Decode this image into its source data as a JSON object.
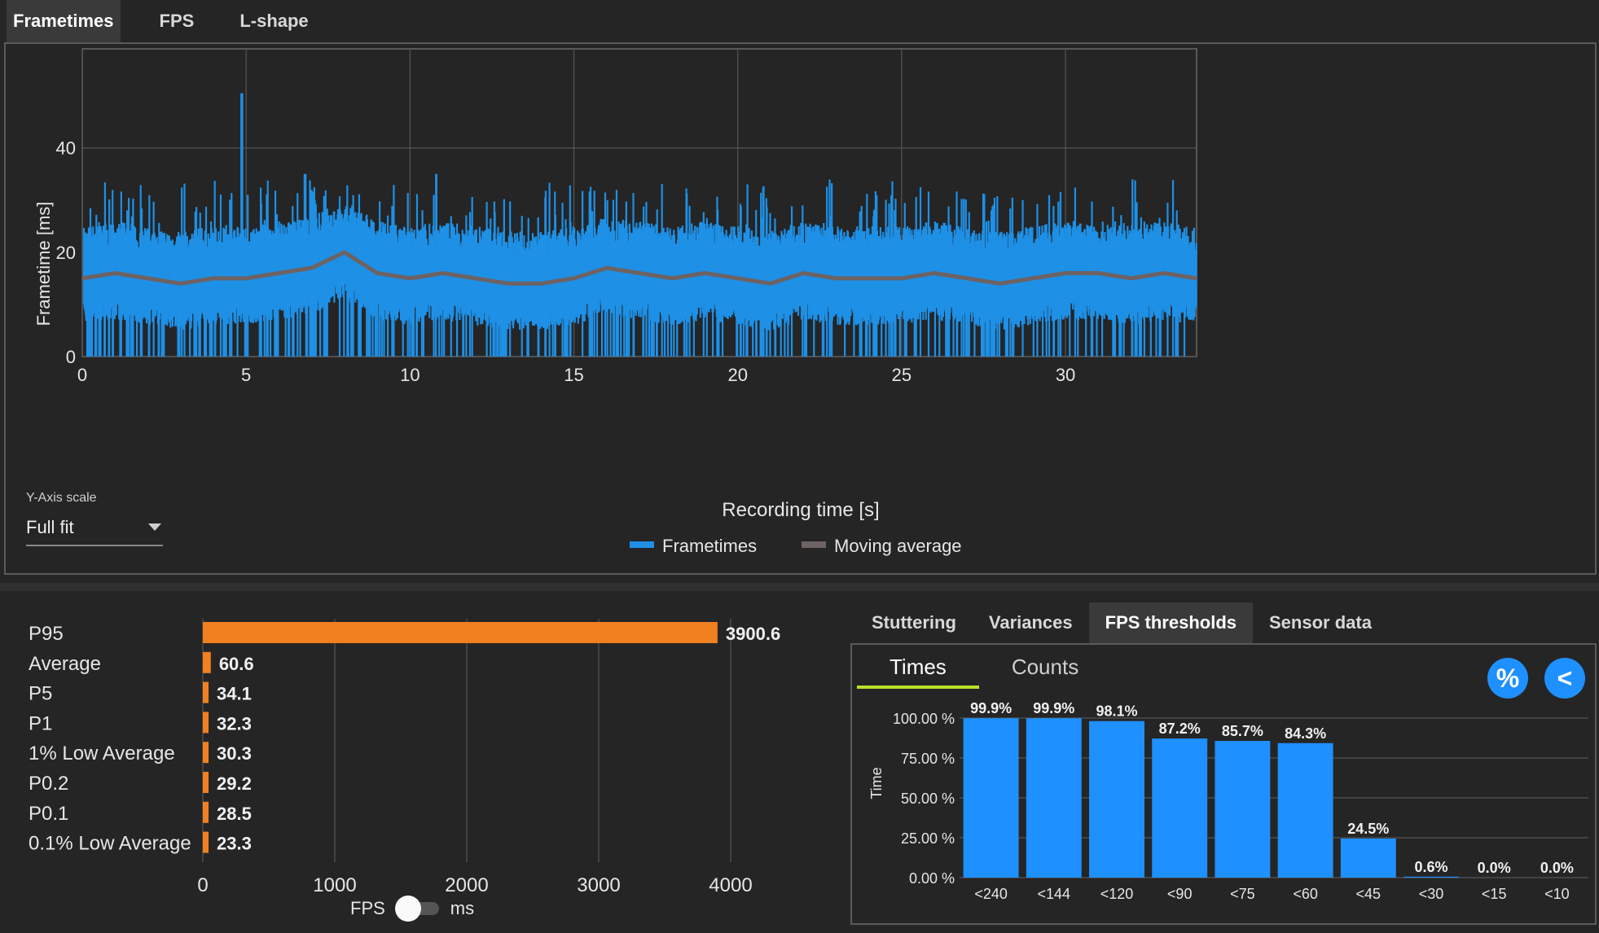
{
  "tabs": [
    "Frametimes",
    "FPS",
    "L-shape"
  ],
  "frametime_chart": {
    "ylabel": "Frametime [ms]",
    "xlabel": "Recording time [s]",
    "xticks": [
      0,
      5,
      10,
      15,
      20,
      25,
      30
    ],
    "yticks": [
      0,
      20,
      40
    ],
    "xlim": [
      0,
      34
    ],
    "ylim": [
      0,
      59
    ],
    "legend": [
      "Frametimes",
      "Moving average"
    ],
    "colors": {
      "frametimes": "#1e90e6",
      "moving_average": "#6e6262"
    }
  },
  "y_axis_scale": {
    "label": "Y-Axis scale",
    "value": "Full fit"
  },
  "stats": {
    "labels": [
      "P95",
      "Average",
      "P5",
      "P1",
      "1% Low Average",
      "P0.2",
      "P0.1",
      "0.1% Low Average"
    ],
    "values": [
      3900.6,
      60.6,
      34.1,
      32.3,
      30.3,
      29.2,
      28.5,
      23.3
    ],
    "value_labels": [
      "3900.6",
      "60.6",
      "34.1",
      "32.3",
      "30.3",
      "29.2",
      "28.5",
      "23.3"
    ],
    "xticks": [
      "0",
      "1000",
      "2000",
      "3000",
      "4000"
    ],
    "xmax": 4000,
    "bar_color": "#f08020"
  },
  "toggle": {
    "left": "FPS",
    "right": "ms"
  },
  "right_tabs": [
    "Stuttering",
    "Variances",
    "FPS thresholds",
    "Sensor data"
  ],
  "subtabs": [
    "Times",
    "Counts"
  ],
  "buttons": {
    "percent": "%",
    "back": "<"
  },
  "chart_data": [
    {
      "type": "line",
      "title": "",
      "xlabel": "Recording time [s]",
      "ylabel": "Frametime [ms]",
      "xlim": [
        0,
        34
      ],
      "ylim": [
        0,
        59
      ],
      "series": [
        {
          "name": "Moving average",
          "x": [
            0,
            1,
            2,
            3,
            4,
            5,
            6,
            7,
            8,
            9,
            10,
            11,
            12,
            13,
            14,
            15,
            16,
            17,
            18,
            19,
            20,
            21,
            22,
            23,
            24,
            25,
            26,
            27,
            28,
            29,
            30,
            31,
            32,
            33,
            34
          ],
          "values": [
            15,
            16,
            15,
            14,
            15,
            15,
            16,
            17,
            20,
            16,
            15,
            16,
            15,
            14,
            14,
            15,
            17,
            16,
            15,
            16,
            15,
            14,
            16,
            15,
            15,
            15,
            16,
            15,
            14,
            15,
            16,
            16,
            15,
            16,
            15
          ]
        }
      ]
    },
    {
      "type": "bar",
      "title": "",
      "xlabel": "",
      "ylabel": "Time",
      "categories": [
        "<240",
        "<144",
        "<120",
        "<90",
        "<75",
        "<60",
        "<45",
        "<30",
        "<15",
        "<10"
      ],
      "values": [
        99.9,
        99.9,
        98.1,
        87.2,
        85.7,
        84.3,
        24.5,
        0.6,
        0.0,
        0.0
      ],
      "value_labels": [
        "99.9%",
        "99.9%",
        "98.1%",
        "87.2%",
        "85.7%",
        "84.3%",
        "24.5%",
        "0.6%",
        "0.0%",
        "0.0%"
      ],
      "yticks": [
        "0.00 %",
        "25.00 %",
        "50.00 %",
        "75.00 %",
        "100.00 %"
      ],
      "ylim": [
        0,
        100
      ],
      "color": "#1e90ff"
    }
  ]
}
